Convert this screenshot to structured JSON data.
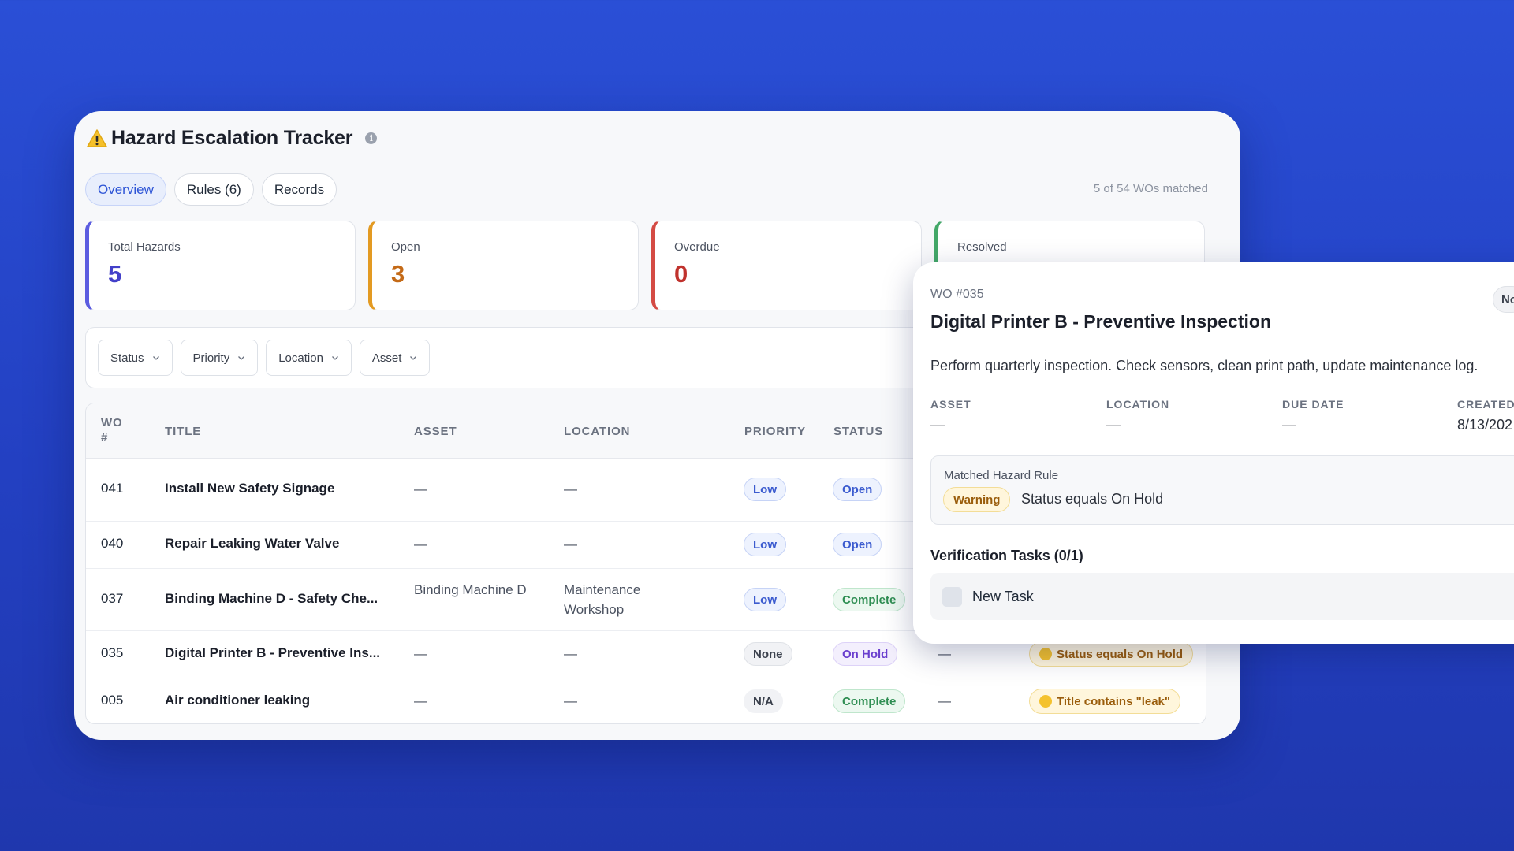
{
  "app": {
    "title": "Hazard Escalation Tracker",
    "icon": "warning-icon"
  },
  "tabs": [
    {
      "label": "Overview",
      "active": true
    },
    {
      "label": "Rules (6)",
      "active": false
    },
    {
      "label": "Records",
      "active": false
    }
  ],
  "matched_count": "5 of 54 WOs matched",
  "stats": [
    {
      "label": "Total Hazards",
      "value": "5",
      "color": "#4340c9"
    },
    {
      "label": "Open",
      "value": "3",
      "color": "#c46a17"
    },
    {
      "label": "Overdue",
      "value": "0",
      "color": "#c0322d"
    },
    {
      "label": "Resolved",
      "value": "",
      "color": "#2f8e53"
    }
  ],
  "filters": [
    "Status",
    "Priority",
    "Location",
    "Asset"
  ],
  "table": {
    "headers": {
      "wo": "WO #",
      "title": "TITLE",
      "asset": "ASSET",
      "location": "LOCATION",
      "priority": "PRIORITY",
      "status": "STATUS"
    },
    "rows": [
      {
        "wo": "041",
        "title": "Install New Safety Signage",
        "asset": "—",
        "location": "—",
        "priority": "Low",
        "status": "Open",
        "col7": "",
        "rule": ""
      },
      {
        "wo": "040",
        "title": "Repair Leaking Water Valve",
        "asset": "—",
        "location": "—",
        "priority": "Low",
        "status": "Open",
        "col7": "",
        "rule": ""
      },
      {
        "wo": "037",
        "title": "Binding Machine D - Safety Che...",
        "asset": "Binding Machine D",
        "location": "Maintenance Workshop",
        "priority": "Low",
        "status": "Complete",
        "col7": "",
        "rule": ""
      },
      {
        "wo": "035",
        "title": "Digital Printer B - Preventive Ins...",
        "asset": "—",
        "location": "—",
        "priority": "None",
        "status": "On Hold",
        "col7": "—",
        "rule": "Status equals On Hold"
      },
      {
        "wo": "005",
        "title": "Air conditioner leaking",
        "asset": "—",
        "location": "—",
        "priority": "N/A",
        "status": "Complete",
        "col7": "—",
        "rule": "Title contains \"leak\""
      }
    ]
  },
  "detail": {
    "wo": "WO #035",
    "title": "Digital Printer B - Preventive Inspection",
    "badge": "No",
    "description": "Perform quarterly inspection. Check sensors, clean print path, update maintenance log.",
    "fields": [
      {
        "label": "ASSET",
        "value": "—"
      },
      {
        "label": "LOCATION",
        "value": "—"
      },
      {
        "label": "DUE DATE",
        "value": "—"
      },
      {
        "label": "CREATED",
        "value": "8/13/202"
      }
    ],
    "matched_rule_label": "Matched Hazard Rule",
    "severity": "Warning",
    "rule_text": "Status equals On Hold",
    "tasks_title": "Verification Tasks (0/1)",
    "task_label": "New Task"
  }
}
